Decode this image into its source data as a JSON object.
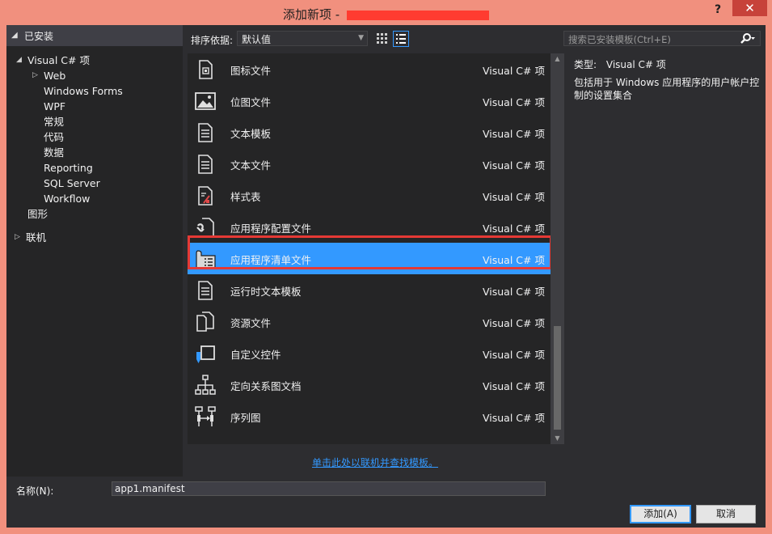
{
  "window": {
    "title": "添加新项 - ",
    "help_glyph": "?",
    "close_glyph": "✕"
  },
  "tree": {
    "header": "已安装",
    "root": "Visual C# 项",
    "children": [
      "Web",
      "Windows Forms",
      "WPF",
      "常规",
      "代码",
      "数据",
      "Reporting",
      "SQL Server",
      "Workflow"
    ],
    "graphics": "图形",
    "online": "联机"
  },
  "toolbar": {
    "sort_label": "排序依据:",
    "sort_value": "默认值"
  },
  "search": {
    "placeholder": "搜索已安装模板(Ctrl+E)"
  },
  "templates": [
    {
      "name": "图标文件",
      "type": "Visual C# 项",
      "icon": "icon-file-icon"
    },
    {
      "name": "位图文件",
      "type": "Visual C# 项",
      "icon": "bitmap-icon"
    },
    {
      "name": "文本模板",
      "type": "Visual C# 项",
      "icon": "text-template-icon"
    },
    {
      "name": "文本文件",
      "type": "Visual C# 项",
      "icon": "text-file-icon"
    },
    {
      "name": "样式表",
      "type": "Visual C# 项",
      "icon": "stylesheet-icon"
    },
    {
      "name": "应用程序配置文件",
      "type": "Visual C# 项",
      "icon": "config-file-icon"
    },
    {
      "name": "应用程序清单文件",
      "type": "Visual C# 项",
      "icon": "manifest-file-icon",
      "selected": true
    },
    {
      "name": "运行时文本模板",
      "type": "Visual C# 项",
      "icon": "runtime-template-icon"
    },
    {
      "name": "资源文件",
      "type": "Visual C# 项",
      "icon": "resource-file-icon"
    },
    {
      "name": "自定义控件",
      "type": "Visual C# 项",
      "icon": "custom-control-icon"
    },
    {
      "name": "定向关系图文档",
      "type": "Visual C# 项",
      "icon": "dgml-icon"
    },
    {
      "name": "序列图",
      "type": "Visual C# 项",
      "icon": "sequence-diagram-icon"
    }
  ],
  "description": {
    "type_label": "类型:",
    "type_value": "Visual C# 项",
    "text": "包括用于 Windows 应用程序的用户帐户控制的设置集合"
  },
  "online_link": "单击此处以联机并查找模板。",
  "name_field": {
    "label": "名称(N):",
    "value": "app1.manifest"
  },
  "buttons": {
    "add": "添加(A)",
    "cancel": "取消"
  },
  "colors": {
    "selection": "#3399ff",
    "highlight_box": "#e53935",
    "titlebar": "#f1907e"
  }
}
